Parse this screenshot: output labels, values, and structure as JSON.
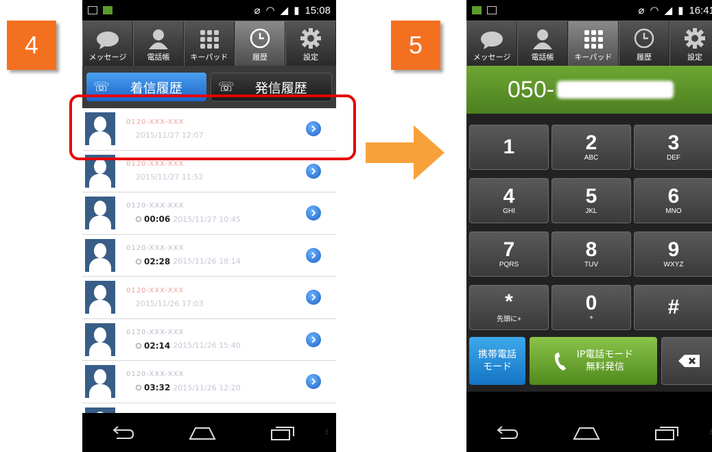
{
  "steps": {
    "left": "4",
    "right": "5"
  },
  "status_left": {
    "time": "15:08"
  },
  "status_right": {
    "time": "16:41"
  },
  "tabs": [
    {
      "label": "メッセージ"
    },
    {
      "label": "電話帳"
    },
    {
      "label": "キーパッド"
    },
    {
      "label": "履歴"
    },
    {
      "label": "設定"
    }
  ],
  "history": {
    "incoming_label": "着信履歴",
    "outgoing_label": "発信履歴",
    "rows": [
      {
        "number": "0120-XXX-XXX",
        "duration": "",
        "date": "2015/11/27 12:07"
      },
      {
        "number": "0120-XXX-XXX",
        "duration": "",
        "date": "2015/11/27 11:52"
      },
      {
        "number": "0120-XXX-XXX",
        "duration": "00:06",
        "date": "2015/11/27 10:45"
      },
      {
        "number": "0120-XXX-XXX",
        "duration": "02:28",
        "date": "2015/11/26 18:14"
      },
      {
        "number": "0120-XXX-XXX",
        "duration": "",
        "date": "2015/11/26 17:03"
      },
      {
        "number": "0120-XXX-XXX",
        "duration": "02:14",
        "date": "2015/11/26 15:40"
      },
      {
        "number": "0120-XXX-XXX",
        "duration": "03:32",
        "date": "2015/11/26 12:20"
      }
    ]
  },
  "dialer": {
    "number_prefix": "050-",
    "keys": [
      {
        "digit": "1",
        "sub": ""
      },
      {
        "digit": "2",
        "sub": "ABC"
      },
      {
        "digit": "3",
        "sub": "DEF"
      },
      {
        "digit": "4",
        "sub": "GHI"
      },
      {
        "digit": "5",
        "sub": "JKL"
      },
      {
        "digit": "6",
        "sub": "MNO"
      },
      {
        "digit": "7",
        "sub": "PQRS"
      },
      {
        "digit": "8",
        "sub": "TUV"
      },
      {
        "digit": "9",
        "sub": "WXYZ"
      },
      {
        "digit": "*",
        "sub": "先頭に+"
      },
      {
        "digit": "0",
        "sub": "+"
      },
      {
        "digit": "#",
        "sub": ""
      }
    ],
    "mobile_mode_line1": "携帯電話",
    "mobile_mode_line2": "モード",
    "ip_mode_line1": "IP電話モード",
    "ip_mode_line2": "無料発信"
  },
  "colors": {
    "step_badge": "#f37021",
    "highlight": "#e60000",
    "arrow": "#f7a13a",
    "display_green": "#5c9128",
    "incoming_blue": "#1c64c8"
  }
}
